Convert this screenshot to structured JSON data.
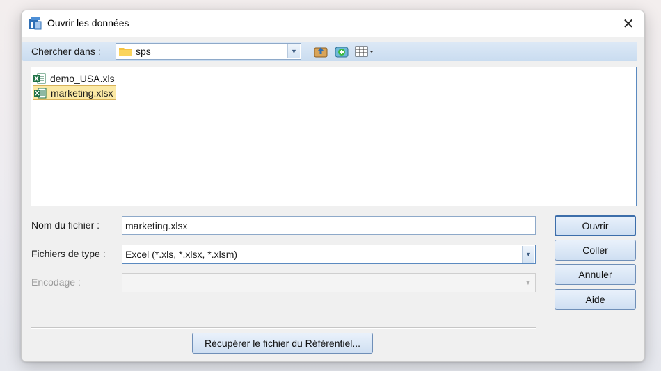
{
  "window": {
    "title": "Ouvrir les données",
    "close_glyph": "✕",
    "app_icon": "spss-app-icon"
  },
  "lookin": {
    "label": "Chercher dans :",
    "value": "sps",
    "icon": "folder-icon"
  },
  "toolbar": {
    "icons": [
      "up-one-level-icon",
      "create-new-folder-icon",
      "view-menu-icon"
    ]
  },
  "files": [
    {
      "name": "demo_USA.xls",
      "icon": "excel-file-icon",
      "selected": false
    },
    {
      "name": "marketing.xlsx",
      "icon": "excel-file-icon",
      "selected": true
    }
  ],
  "filename": {
    "label": "Nom du fichier :",
    "value": "marketing.xlsx"
  },
  "filetype": {
    "label": "Fichiers de type :",
    "value": "Excel (*.xls, *.xlsx, *.xlsm)"
  },
  "encoding": {
    "label": "Encodage :",
    "value": ""
  },
  "buttons": {
    "open": "Ouvrir",
    "paste": "Coller",
    "cancel": "Annuler",
    "help": "Aide",
    "repository": "Récupérer le fichier du Référentiel..."
  },
  "colors": {
    "selection_bg": "#fbe9a5",
    "button_border": "#6f8fb8",
    "list_border": "#5b8ac0"
  }
}
